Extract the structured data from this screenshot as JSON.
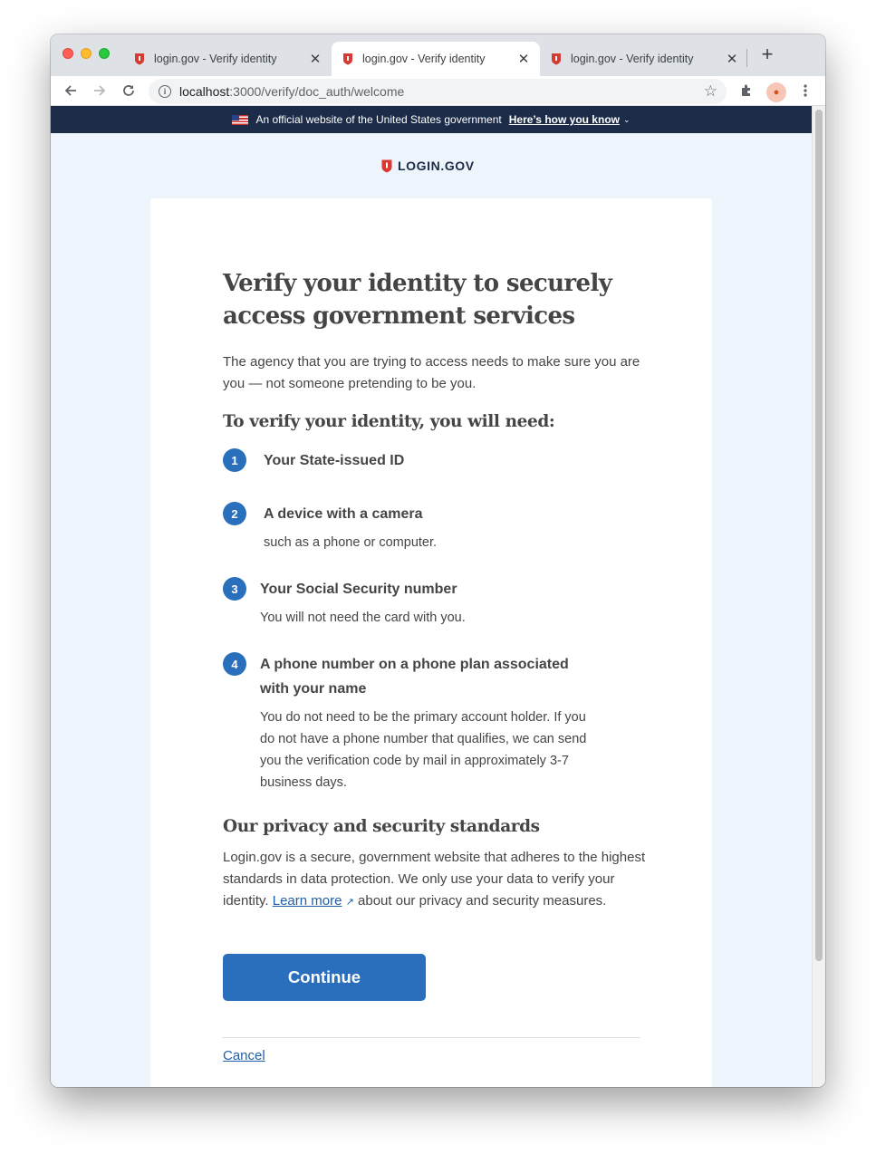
{
  "browser": {
    "tabs": [
      {
        "title": "login.gov - Verify identity",
        "close": "✕"
      },
      {
        "title": "login.gov - Verify identity",
        "close": "✕"
      },
      {
        "title": "login.gov - Verify identity",
        "close": "✕"
      }
    ],
    "new_tab": "+",
    "url_host": "localhost",
    "url_path": ":3000/verify/doc_auth/welcome"
  },
  "gov_banner": {
    "text": "An official website of the United States government",
    "link": "Here’s how you know"
  },
  "logo": {
    "text": "LOGIN.GOV"
  },
  "page": {
    "title": "Verify your identity to securely access government services",
    "intro": "The agency that you are trying to access needs to make sure you are you — not someone pretending to be you.",
    "need_heading": "To verify your identity, you will need:",
    "steps": [
      {
        "num": "1",
        "title": "Your State-issued ID",
        "desc": ""
      },
      {
        "num": "2",
        "title": "A device with a camera",
        "desc": "such as a phone or computer."
      },
      {
        "num": "3",
        "title": "Your Social Security number",
        "desc": "You will not need the card with you."
      },
      {
        "num": "4",
        "title": "A phone number on a phone plan associated with your name",
        "desc": "You do not need to be the primary account holder. If you do not have a phone number that qualifies, we can send you the verification code by mail in approximately 3-7 business days."
      }
    ],
    "privacy_heading": "Our privacy and security standards",
    "privacy_text_before": "Login.gov is a secure, government website that adheres to the highest standards in data protection. We only use your data to verify your identity. ",
    "privacy_link": "Learn more",
    "privacy_text_after": " about our privacy and security measures.",
    "continue_label": "Continue",
    "cancel_label": "Cancel"
  },
  "colors": {
    "primary": "#2a6fbc",
    "banner": "#1b2b48",
    "page_bg": "#eef4fb",
    "shield_red": "#d83933"
  }
}
